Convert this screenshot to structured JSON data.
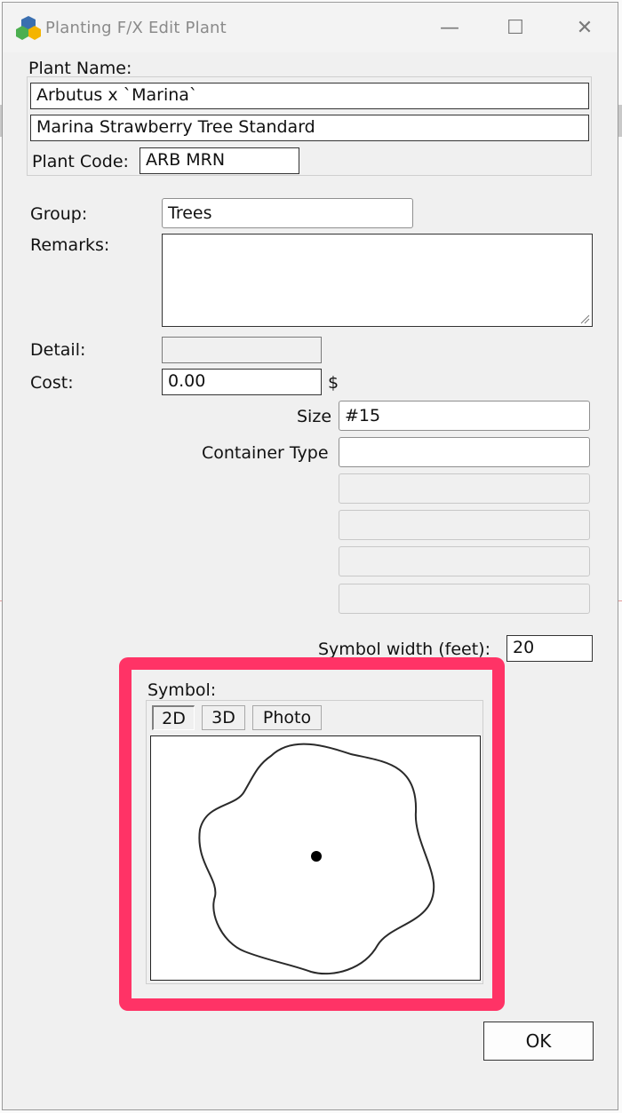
{
  "window": {
    "title": "Planting F/X Edit Plant",
    "minimize_glyph": "—",
    "maximize_glyph": "☐",
    "close_glyph": "✕",
    "app_icon": "planting-fx-logo-icon"
  },
  "plant_name": {
    "label": "Plant Name:",
    "botanical": "Arbutus x `Marina`",
    "common": "Marina Strawberry Tree Standard",
    "code_label": "Plant Code:",
    "code": "ARB MRN"
  },
  "group": {
    "label": "Group:",
    "value": "Trees"
  },
  "remarks": {
    "label": "Remarks:",
    "value": ""
  },
  "detail": {
    "label": "Detail:",
    "value": ""
  },
  "cost": {
    "label": "Cost:",
    "value": "0.00",
    "unit": "$"
  },
  "size": {
    "label": "Size",
    "value": "#15"
  },
  "container": {
    "label": "Container Type",
    "value": "",
    "extra_fields": [
      "",
      "",
      "",
      ""
    ]
  },
  "symbol_width": {
    "label": "Symbol width (feet):",
    "value": "20"
  },
  "symbol": {
    "label": "Symbol:",
    "tabs": [
      {
        "label": "2D",
        "active": true
      },
      {
        "label": "3D",
        "active": false
      },
      {
        "label": "Photo",
        "active": false
      }
    ],
    "highlight_color": "#ff3366"
  },
  "buttons": {
    "ok": "OK"
  }
}
